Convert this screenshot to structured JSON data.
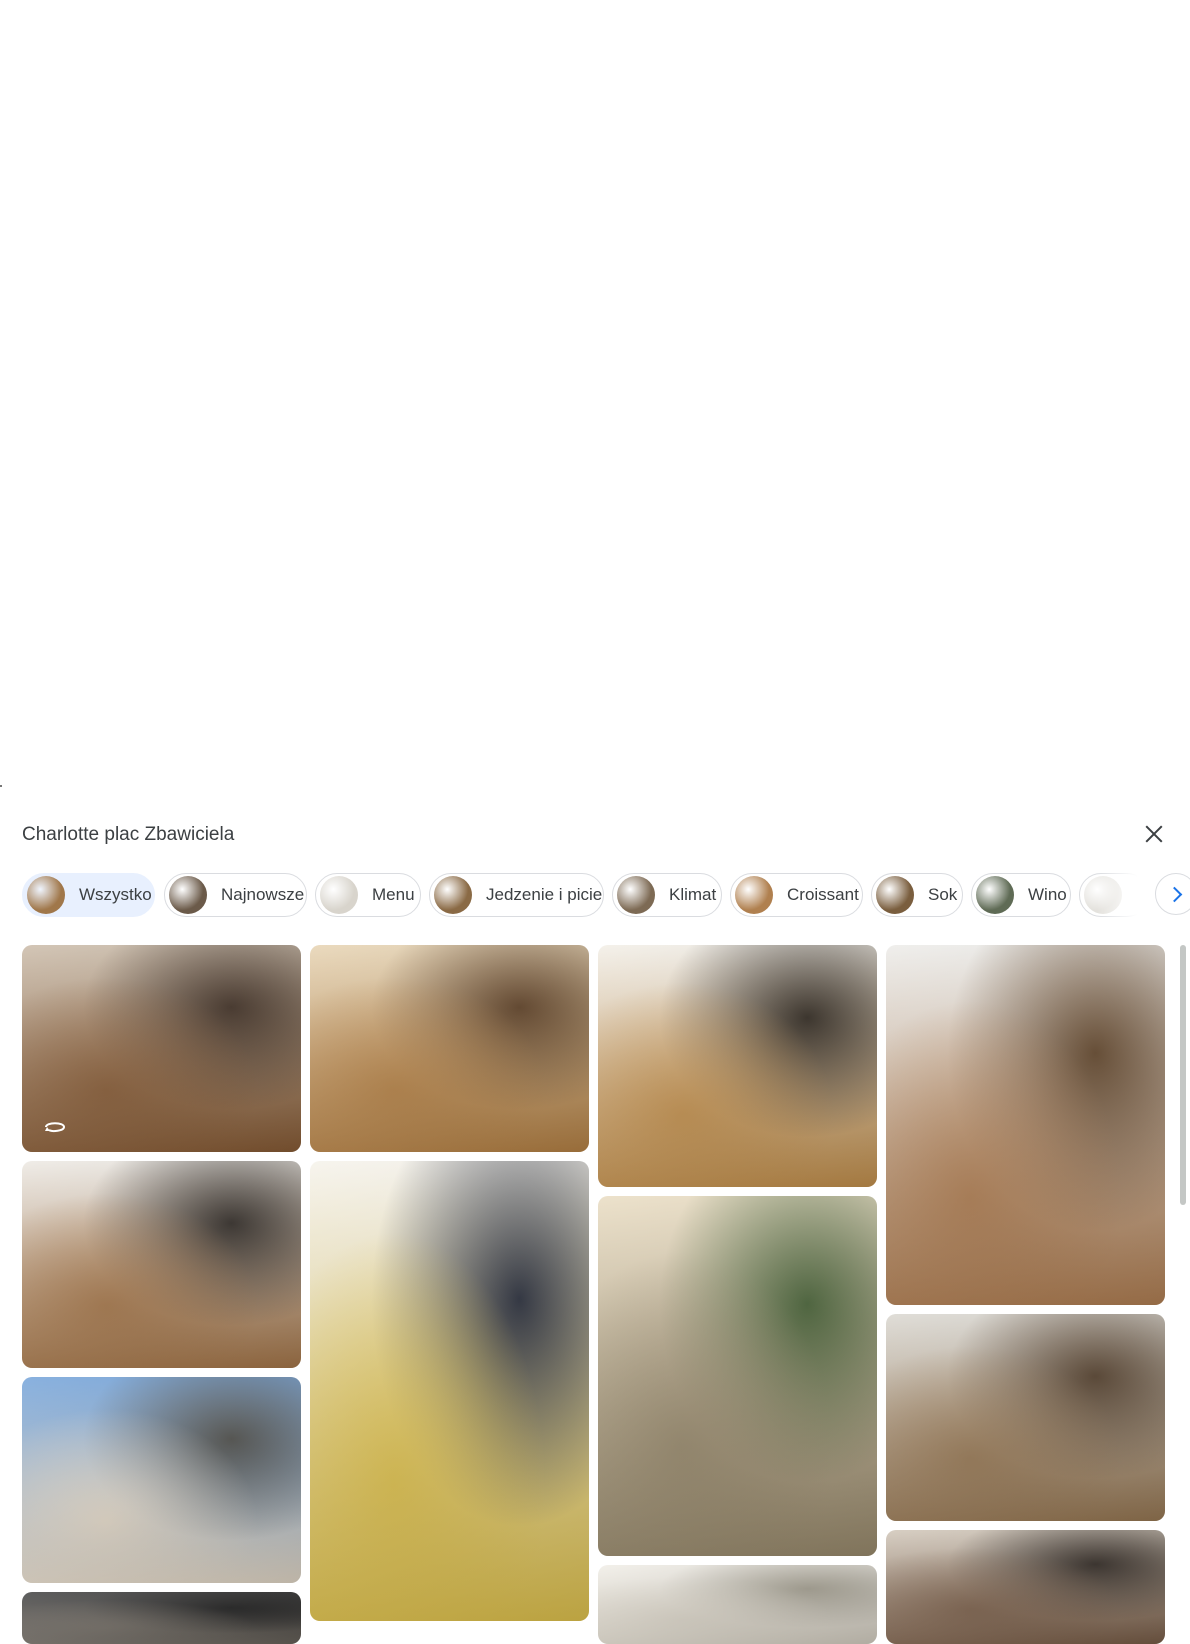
{
  "header": {
    "title": "Charlotte plac Zbawiciela",
    "close_label": "Zamknij"
  },
  "filters": [
    {
      "label": "Wszystko",
      "active": true,
      "thumb": "#a0774a"
    },
    {
      "label": "Najnowsze",
      "active": false,
      "thumb": "#6b5a49"
    },
    {
      "label": "Menu",
      "active": false,
      "thumb": "#d8d4cc"
    },
    {
      "label": "Jedzenie i picie",
      "active": false,
      "thumb": "#8a6a45"
    },
    {
      "label": "Klimat",
      "active": false,
      "thumb": "#7d6a54"
    },
    {
      "label": "Croissant",
      "active": false,
      "thumb": "#b0804f"
    },
    {
      "label": "Sok",
      "active": false,
      "thumb": "#7a5e3e"
    },
    {
      "label": "Wino",
      "active": false,
      "thumb": "#5f6b55"
    },
    {
      "label": "",
      "active": false,
      "thumb": "#e4e2dd"
    }
  ],
  "photos": [
    {
      "name": "bakery-interior",
      "colors": [
        "#c9b9a6",
        "#8a5d36",
        "#3b2a1e"
      ],
      "pano": true
    },
    {
      "name": "breakfast-table",
      "colors": [
        "#e6d2b0",
        "#b98446",
        "#5a3b1f"
      ],
      "pano": false
    },
    {
      "name": "toast-plate",
      "colors": [
        "#f2eee6",
        "#c7934e",
        "#2a2219"
      ],
      "pano": false
    },
    {
      "name": "pastry-display",
      "colors": [
        "#ecebe8",
        "#b58255",
        "#5b3e22"
      ],
      "pano": false
    },
    {
      "name": "breakfast-spread",
      "colors": [
        "#ece8e2",
        "#a9794b",
        "#2b2520"
      ],
      "pano": false
    },
    {
      "name": "omelette-salad",
      "colors": [
        "#f5f2ea",
        "#e4c64f",
        "#1d2230"
      ],
      "pano": false
    },
    {
      "name": "building-facade",
      "colors": [
        "#e8dbc0",
        "#9c8d6f",
        "#3f5a2d"
      ],
      "pano": false
    },
    {
      "name": "cafe-interior",
      "colors": [
        "#d9d6cf",
        "#9a7a55",
        "#4f3a26"
      ],
      "pano": false
    },
    {
      "name": "square-street",
      "colors": [
        "#6fa0d8",
        "#e7dccb",
        "#4a4a46"
      ],
      "pano": false
    },
    {
      "name": "umbrella-terrace",
      "colors": [
        "#f0ede6",
        "#d8d2c5",
        "#a7a293"
      ],
      "pano": false
    },
    {
      "name": "cafe-guests",
      "colors": [
        "#cfc4b6",
        "#7a5e48",
        "#2e2620"
      ],
      "pano": false
    },
    {
      "name": "dark-interior",
      "colors": [
        "#3a3a3a",
        "#6a645c",
        "#1e1e1e"
      ],
      "pano": false
    }
  ]
}
